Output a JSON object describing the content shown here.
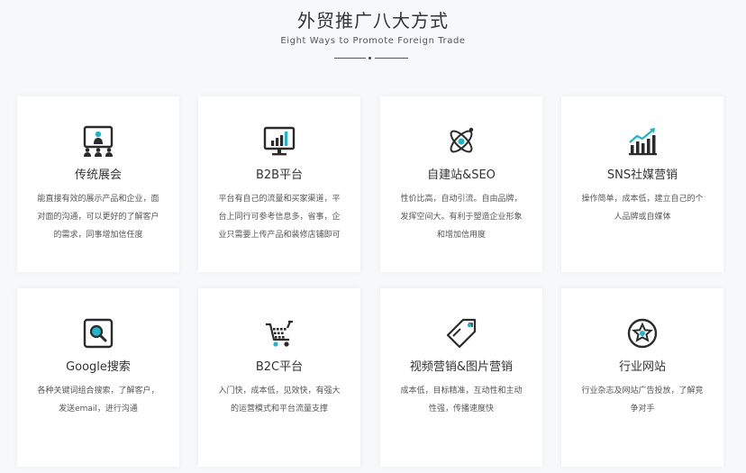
{
  "header": {
    "title": "外贸推广八大方式",
    "subtitle": "Eight Ways to Promote Foreign Trade"
  },
  "colors": {
    "accent": "#1fb5c7",
    "icon_dark": "#2b2b2b"
  },
  "cards": [
    {
      "icon": "exhibition-icon",
      "title": "传统展会",
      "desc": [
        "能直接有效的展示产品和企业，面",
        "对面的沟通，可以更好的了解客户",
        "的需求，同事增加信任度"
      ]
    },
    {
      "icon": "monitor-chart-icon",
      "title": "B2B平台",
      "desc": [
        "平台有自己的流量和买家渠道，平",
        "台上同行可参考信息多，省事，企",
        "业只需要上传产品和装修店铺即可"
      ]
    },
    {
      "icon": "atom-icon",
      "title": "自建站&SEO",
      "desc": [
        "性价比高，自动引流。自由品牌，",
        "发挥空间大。有利于塑造企业形象",
        "和增加信用度"
      ]
    },
    {
      "icon": "growth-chart-icon",
      "title": "SNS社媒营销",
      "desc": [
        "操作简单，成本低，建立自己的个",
        "人品牌或自媒体"
      ]
    },
    {
      "icon": "search-icon",
      "title": "Google搜索",
      "desc": [
        "各种关键词组合搜索，了解客户，",
        "发送email，进行沟通"
      ]
    },
    {
      "icon": "shopping-cart-icon",
      "title": "B2C平台",
      "desc": [
        "入门快，成本低，见效快，有强大",
        "的运营模式和平台流量支撑"
      ]
    },
    {
      "icon": "tag-icon",
      "title": "视频营销&图片营销",
      "desc": [
        "成本低，目标精准，互动性和主动",
        "性强，传播速度快"
      ]
    },
    {
      "icon": "star-badge-icon",
      "title": "行业网站",
      "desc": [
        "行业杂志及网站广告投放，了解竞",
        "争对手"
      ]
    }
  ]
}
